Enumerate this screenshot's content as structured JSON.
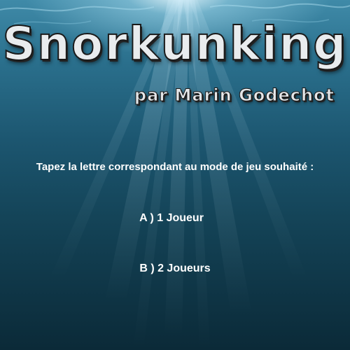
{
  "game": {
    "title": "Snorkunking",
    "subtitle": "par Marin Godechot",
    "prompt": "Tapez la lettre correspondant au mode de jeu souhaité :",
    "options": [
      {
        "label": "A ) 1 Joueur"
      },
      {
        "label": "B ) 2 Joueurs"
      }
    ]
  },
  "colors": {
    "water_top": "#3f8aa8",
    "water_bottom": "#0b2a38",
    "text": "#ffffff",
    "title_fill": "#e9ecee"
  }
}
